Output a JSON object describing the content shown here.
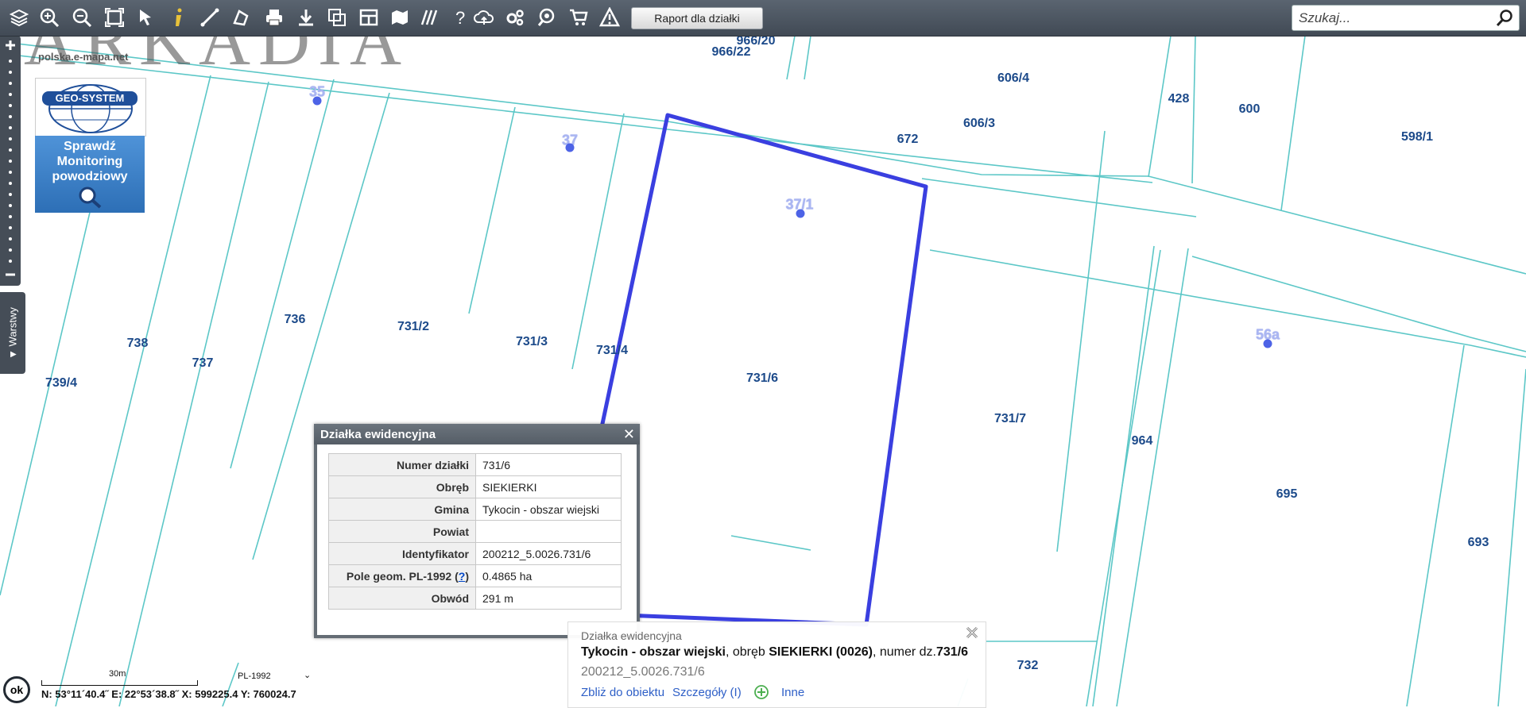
{
  "toolbar": {
    "icons": [
      "layers-icon",
      "zoom-in-icon",
      "zoom-out-icon",
      "zoom-extent-icon",
      "select-arrow-icon",
      "info-icon",
      "measure-distance-icon",
      "measure-area-icon",
      "print-icon",
      "download-icon",
      "copy-icon",
      "layout-icon",
      "map-icon",
      "hatch-icon",
      "help-icon",
      "cloud-upload-icon",
      "settings-icon",
      "search-zoom-icon",
      "cart-icon",
      "warning-icon"
    ],
    "report_label": "Raport dla działki",
    "search_placeholder": "Szukaj..."
  },
  "branding": {
    "watermark": "ARKADIA",
    "site_url": "polska.e-mapa.net",
    "geo_system_logo": "GEO-SYSTEM",
    "flood_banner": "Sprawdź Monitoring powodziowy"
  },
  "sidebar": {
    "layers_tab": "Warstwy"
  },
  "map": {
    "parcel_labels": [
      "966/20",
      "966/22",
      "606/4",
      "428",
      "600",
      "598/1",
      "606/3",
      "672",
      "736",
      "738",
      "737",
      "739/4",
      "731/2",
      "731/3",
      "731/4",
      "731/6",
      "731/7",
      "964",
      "695",
      "693",
      "732"
    ],
    "address_labels": [
      "35",
      "37",
      "37/1",
      "56a"
    ],
    "colors": {
      "parcel_line": "#5cc7c7",
      "selected_parcel": "#3a3fe0",
      "address": "#4d63e6"
    }
  },
  "popup": {
    "title": "Działka ewidencyjna",
    "rows": [
      {
        "key": "Numer działki",
        "value": "731/6"
      },
      {
        "key": "Obręb",
        "value": "SIEKIERKI"
      },
      {
        "key": "Gmina",
        "value": "Tykocin - obszar wiejski"
      },
      {
        "key": "Powiat",
        "value": ""
      },
      {
        "key": "Identyfikator",
        "value": "200212_5.0026.731/6"
      },
      {
        "key": "Pole geom. PL-1992",
        "help": "?",
        "value": "0.4865 ha"
      },
      {
        "key": "Obwód",
        "value": "291 m"
      }
    ]
  },
  "info_panel": {
    "title": "Działka ewidencyjna",
    "gmina": "Tykocin - obszar wiejski",
    "obreb_prefix": ", obręb ",
    "obreb": "SIEKIERKI (0026)",
    "numer_prefix": ", numer dz.",
    "numer": "731/6",
    "identifier": "200212_5.0026.731/6",
    "links": {
      "zoom": "Zbliż do obiektu",
      "details": "Szczegóły (I)",
      "other": "Inne"
    }
  },
  "status": {
    "ok_label": "ok",
    "scale_label": "30m",
    "crs": "PL-1992",
    "coordinates": "N: 53°11´40.4˝ E: 22°53´38.8˝ X: 599225.4 Y: 760024.7"
  }
}
